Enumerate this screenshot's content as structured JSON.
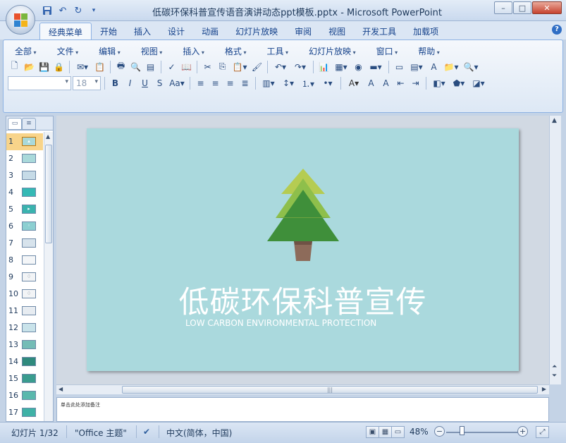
{
  "window": {
    "title": "低碳环保科普宣传语音演讲动态ppt模板.pptx - Microsoft PowerPoint",
    "controls": [
      "–",
      "□",
      "✕"
    ]
  },
  "quick_access": [
    "save-icon",
    "undo-icon",
    "redo-icon",
    "customize-icon"
  ],
  "ribbon_tabs": [
    "经典菜单",
    "开始",
    "插入",
    "设计",
    "动画",
    "幻灯片放映",
    "审阅",
    "视图",
    "开发工具",
    "加载项"
  ],
  "active_tab": "经典菜单",
  "menu": [
    "全部",
    "文件",
    "编辑",
    "视图",
    "插入",
    "格式",
    "工具",
    "幻灯片放映",
    "窗口",
    "帮助"
  ],
  "font_size": "18",
  "font_name": "",
  "slides": [
    {
      "num": "1"
    },
    {
      "num": "2"
    },
    {
      "num": "3"
    },
    {
      "num": "4"
    },
    {
      "num": "5"
    },
    {
      "num": "6"
    },
    {
      "num": "7"
    },
    {
      "num": "8"
    },
    {
      "num": "9"
    },
    {
      "num": "10"
    },
    {
      "num": "11"
    },
    {
      "num": "12"
    },
    {
      "num": "13"
    },
    {
      "num": "14"
    },
    {
      "num": "15"
    },
    {
      "num": "16"
    },
    {
      "num": "17"
    }
  ],
  "current_slide": {
    "title": "低碳环保科普宣传",
    "subtitle": "LOW CARBON ENVIRONMENTAL PROTECTION",
    "background": "#aad9dd",
    "tree_colors": [
      "#b5cc52",
      "#8ebf4b",
      "#3f8f3a",
      "#8d6b5a"
    ]
  },
  "notes": {
    "placeholder": "单击此处添加备注"
  },
  "status": {
    "slide_info": "幻灯片 1/32",
    "theme": "\"Office 主题\"",
    "language": "中文(简体，中国)",
    "zoom": "48%"
  }
}
